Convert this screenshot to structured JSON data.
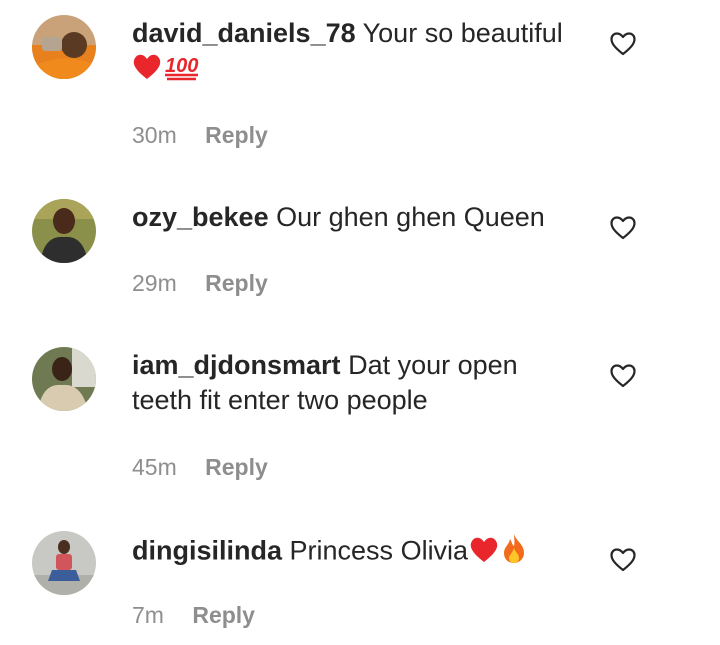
{
  "comments": [
    {
      "username": "david_daniels_78",
      "text": "Your so beautiful",
      "emojis": "❤️💯",
      "time": "30m",
      "reply_label": "Reply",
      "like_icon": "heart-outline-icon"
    },
    {
      "username": "ozy_bekee",
      "text": "Our ghen ghen Queen",
      "time": "29m",
      "reply_label": "Reply",
      "like_icon": "heart-outline-icon"
    },
    {
      "username": "iam_djdonsmart",
      "text": "Dat your open teeth fit enter two people",
      "time": "45m",
      "reply_label": "Reply",
      "like_icon": "heart-outline-icon"
    },
    {
      "username": "dingisilinda",
      "text": "Princess Olivia",
      "emojis": "❤️🔥",
      "time": "7m",
      "reply_label": "Reply",
      "like_icon": "heart-outline-icon"
    }
  ],
  "colors": {
    "text": "#262626",
    "secondary": "#8e8e8e",
    "background": "#ffffff"
  }
}
